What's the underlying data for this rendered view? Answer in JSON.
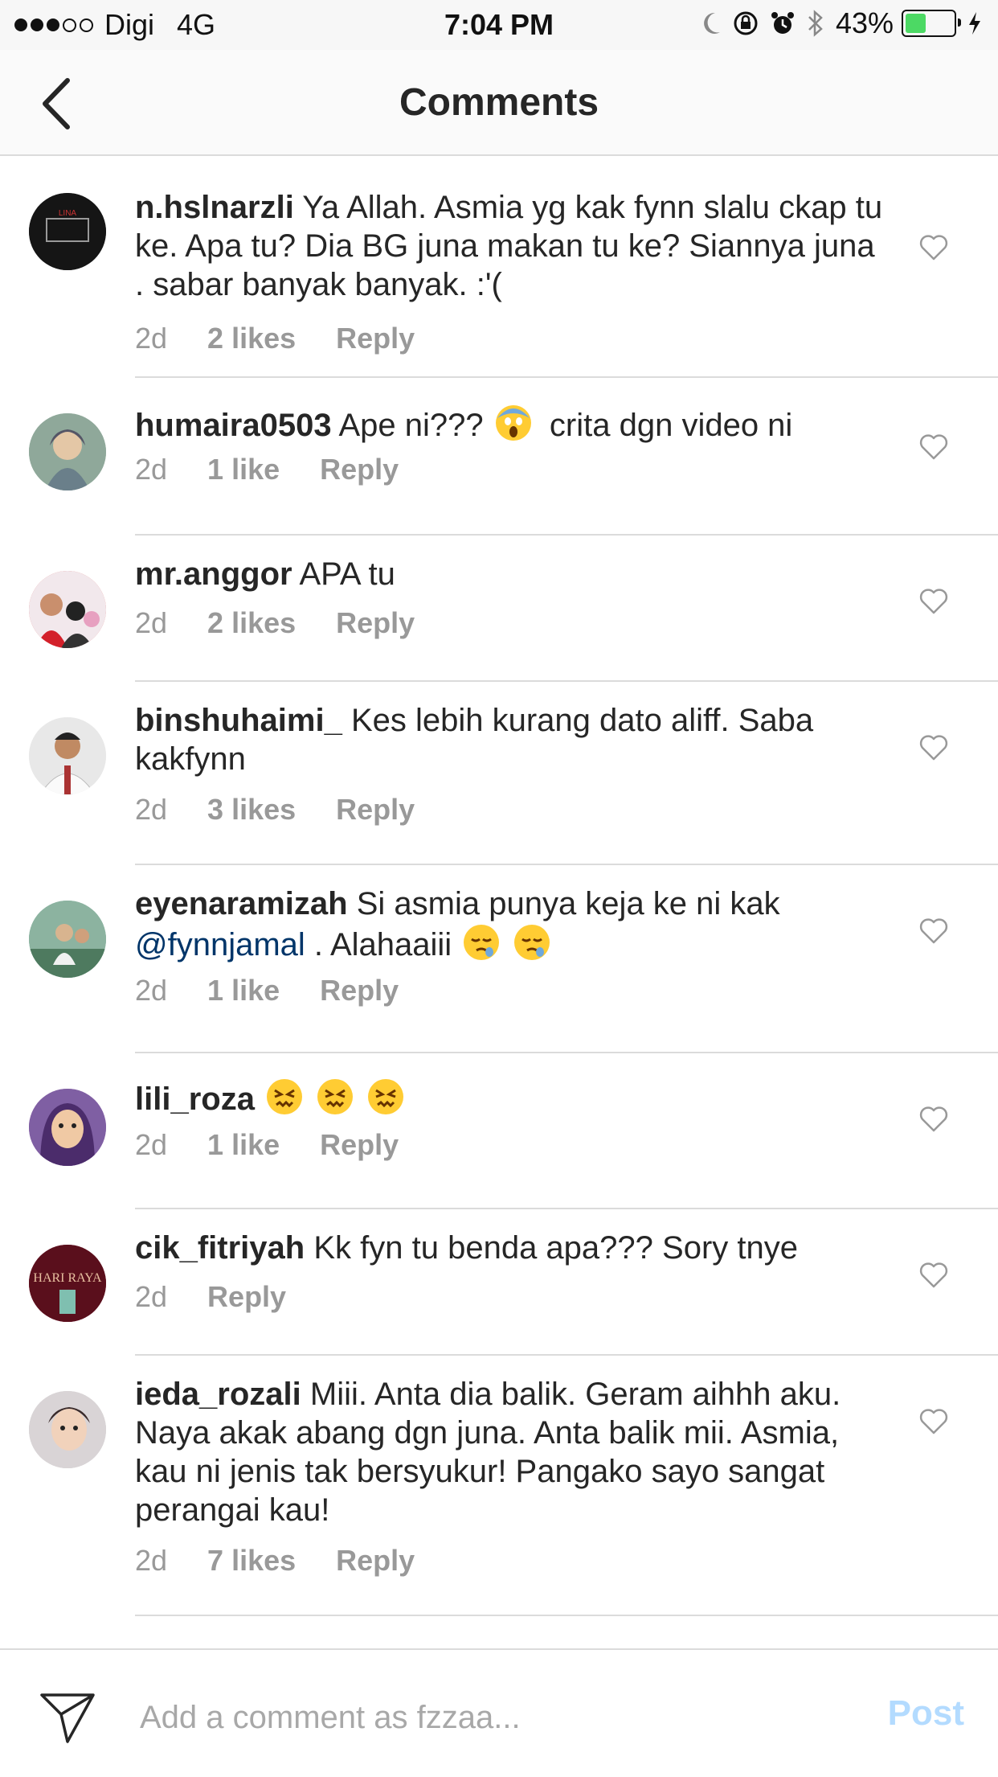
{
  "status_bar": {
    "carrier": "Digi",
    "network": "4G",
    "time": "7:04 PM",
    "battery": "43%",
    "battery_level": 0.43
  },
  "nav": {
    "title": "Comments"
  },
  "colors": {
    "mention": "#003569",
    "post_disabled": "#b3dbff",
    "meta": "#999999"
  },
  "comments": [
    {
      "username": "n.hslnarzli",
      "text": "Ya Allah. Asmia yg kak fynn slalu ckap tu ke. Apa tu? Dia BG juna makan tu ke? Siannya juna . sabar banyak banyak. :'(",
      "time": "2d",
      "likes": "2 likes",
      "reply": "Reply"
    },
    {
      "username": "humaira0503",
      "text": "Ape ni???",
      "text_after": "crita dgn video ni",
      "emoji": "scream-emoji",
      "time": "2d",
      "likes": "1 like",
      "reply": "Reply"
    },
    {
      "username": "mr.anggor",
      "text": "APA tu",
      "time": "2d",
      "likes": "2 likes",
      "reply": "Reply"
    },
    {
      "username": "binshuhaimi_",
      "text": "Kes lebih kurang dato aliff. Saba kakfynn",
      "time": "2d",
      "likes": "3 likes",
      "reply": "Reply"
    },
    {
      "username": "eyenaramizah",
      "text": "Si asmia punya keja ke ni kak",
      "mention": "@fynnjamal",
      "text_after": ". Alahaaiii",
      "emoji": "sleepy-face-emoji",
      "time": "2d",
      "likes": "1 like",
      "reply": "Reply"
    },
    {
      "username": "lili_roza",
      "text": "",
      "emoji": "confounded-face-emoji",
      "time": "2d",
      "likes": "1 like",
      "reply": "Reply"
    },
    {
      "username": "cik_fitriyah",
      "text": "Kk fyn tu benda apa??? Sory tnye",
      "time": "2d",
      "reply": "Reply"
    },
    {
      "username": "ieda_rozali",
      "text": "Miii. Anta dia balik. Geram aihhh aku. Naya akak abang dgn juna. Anta balik mii. Asmia, kau ni jenis tak bersyukur! Pangako sayo sangat perangai kau!",
      "time": "2d",
      "likes": "7 likes",
      "reply": "Reply"
    }
  ],
  "composer": {
    "placeholder": "Add a comment as fzzaa...",
    "post_label": "Post"
  }
}
